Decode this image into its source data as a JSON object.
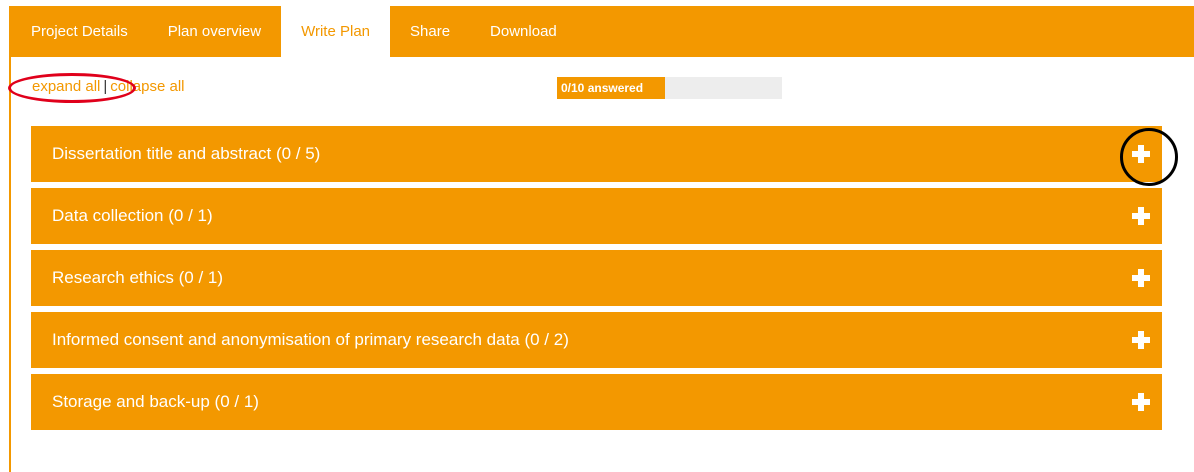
{
  "colors": {
    "accent": "#f39800",
    "annotation_red": "#e0001b",
    "annotation_black": "#000000"
  },
  "tabs": [
    {
      "label": "Project Details",
      "active": false
    },
    {
      "label": "Plan overview",
      "active": false
    },
    {
      "label": "Write Plan",
      "active": true
    },
    {
      "label": "Share",
      "active": false
    },
    {
      "label": "Download",
      "active": false
    }
  ],
  "controls": {
    "expand_all": "expand all",
    "separator": "|",
    "collapse_all": "collapse all"
  },
  "progress": {
    "label": "0/10 answered",
    "answered": 0,
    "total": 10
  },
  "sections": [
    {
      "title": "Dissertation title and abstract (0 / 5)",
      "icon": "plus-icon"
    },
    {
      "title": "Data collection (0 / 1)",
      "icon": "plus-icon"
    },
    {
      "title": "Research ethics (0 / 1)",
      "icon": "plus-icon"
    },
    {
      "title": "Informed consent and anonymisation of primary research data (0 / 2)",
      "icon": "plus-icon"
    },
    {
      "title": "Storage and back-up (0 / 1)",
      "icon": "plus-icon"
    }
  ]
}
